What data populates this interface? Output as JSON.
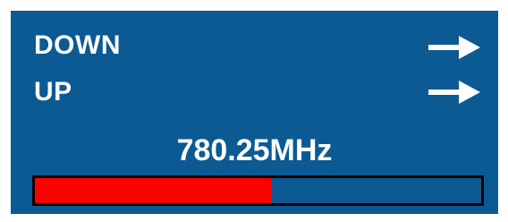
{
  "tuner": {
    "rows": [
      {
        "label": "DOWN",
        "icon": "arrow-right-icon"
      },
      {
        "label": "UP",
        "icon": "arrow-right-icon"
      }
    ],
    "frequency": "780.25MHz",
    "progress": {
      "fraction": 0.53,
      "fill_color": "#ff0000",
      "track_color": "#0b5a93"
    },
    "background_color": "#0b5a93",
    "text_color": "#ffffff"
  }
}
